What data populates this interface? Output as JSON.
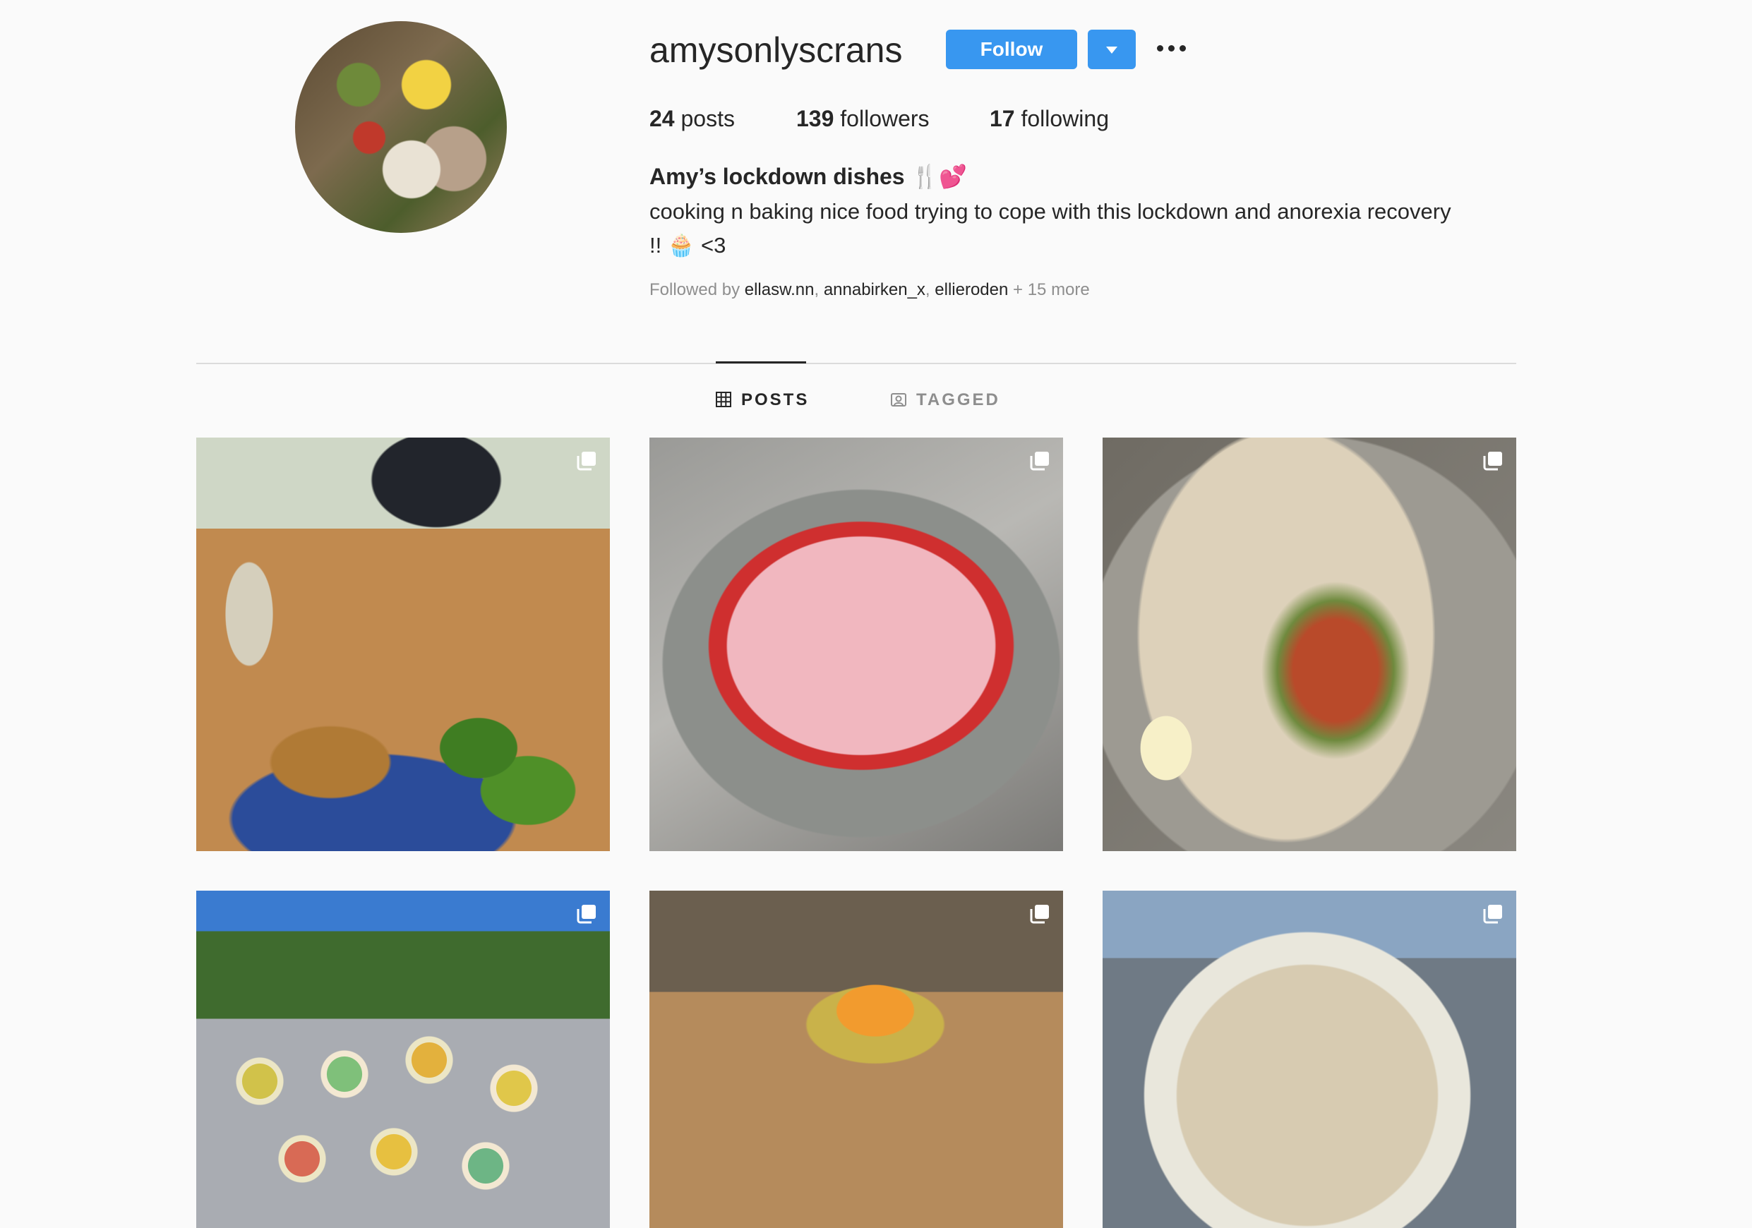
{
  "profile": {
    "username": "amysonlyscrans",
    "follow_label": "Follow",
    "stats": {
      "posts_count": "24",
      "posts_label": "posts",
      "followers_count": "139",
      "followers_label": "followers",
      "following_count": "17",
      "following_label": "following"
    },
    "bio_title": "Amy’s lockdown dishes 🍴💕",
    "bio_line1": "cooking n baking nice food trying to cope with this lockdown and anorexia recovery",
    "bio_line2": "!! 🧁 <3",
    "followed_by": {
      "prefix": "Followed by",
      "names": [
        "ellasw.nn",
        "annabirken_x",
        "ellieroden"
      ],
      "more": "+ 15 more"
    }
  },
  "tabs": [
    {
      "label": "POSTS",
      "icon": "grid-icon",
      "active": true
    },
    {
      "label": "TAGGED",
      "icon": "tagged-icon",
      "active": false
    }
  ],
  "posts": [
    {
      "subject": "dinner-plate-broccoli",
      "icon": "carousel-icon"
    },
    {
      "subject": "strawberry-heart-cake",
      "icon": "carousel-icon"
    },
    {
      "subject": "fajita-wrap",
      "icon": "carousel-icon"
    },
    {
      "subject": "rainbow-bagels",
      "icon": "carousel-icon"
    },
    {
      "subject": "fudge-squares",
      "icon": "carousel-icon"
    },
    {
      "subject": "pasta-bowl",
      "icon": "carousel-icon"
    }
  ],
  "colors": {
    "accent": "#3897f0",
    "background": "#fafafa",
    "text": "#262626",
    "muted": "#8e8e8e",
    "divider": "#dbdbdb"
  }
}
